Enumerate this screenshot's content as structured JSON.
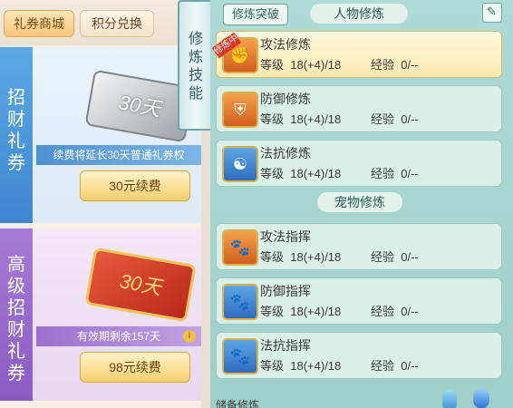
{
  "left_panel": {
    "tabs": [
      "礼券商城",
      "积分兑换"
    ],
    "cards": [
      {
        "title": "招财礼券",
        "ticket_label": "30天",
        "info": "续费将延长30天普通礼券权",
        "button": "30元续费"
      },
      {
        "title": "高级招财礼券",
        "ticket_label": "30天",
        "info": "有效期剩余157天",
        "info_icon": "i",
        "button": "98元续费"
      }
    ]
  },
  "divider": {
    "label": "修炼技能"
  },
  "right_panel": {
    "breakthrough_button": "修炼突破",
    "character_section": "人物修炼",
    "pet_section": "宠物修炼",
    "level_label": "等级",
    "exp_label": "经验",
    "active_badge": "修炼中",
    "character_skills": [
      {
        "name": "攻法修炼",
        "level": "18(+4)/18",
        "exp": "0/--",
        "icon": "fist-icon",
        "active": true
      },
      {
        "name": "防御修炼",
        "level": "18(+4)/18",
        "exp": "0/--",
        "icon": "shield-icon",
        "active": false
      },
      {
        "name": "法抗修炼",
        "level": "18(+4)/18",
        "exp": "0/--",
        "icon": "yin-yang-icon",
        "active": false
      }
    ],
    "pet_skills": [
      {
        "name": "攻法指挥",
        "level": "18(+4)/18",
        "exp": "0/--",
        "icon": "paw-attack-icon"
      },
      {
        "name": "防御指挥",
        "level": "18(+4)/18",
        "exp": "0/--",
        "icon": "paw-shield-icon"
      },
      {
        "name": "法抗指挥",
        "level": "18(+4)/18",
        "exp": "0/--",
        "icon": "paw-magic-icon"
      }
    ],
    "bottom_label": "储备修炼"
  }
}
